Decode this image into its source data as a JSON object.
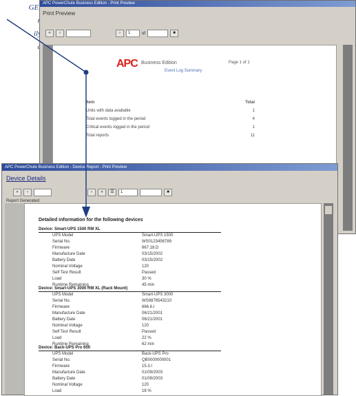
{
  "caption": [
    "GE:",
    "n",
    "ily",
    "d"
  ],
  "back_window": {
    "title": "APC PowerChute Business Edition - Print Preview",
    "app_heading": "Print Preview",
    "toolbar": {
      "zoom_value": "",
      "page_value": "1",
      "of_label": "of",
      "find_value": ""
    },
    "report": {
      "logo": "APC",
      "logo_text": "Business Edition",
      "logo_sub": "Event Log Summary",
      "right_text": "Page 1 of 1",
      "summary": {
        "header": [
          "Item",
          "Total"
        ],
        "rows": [
          [
            "Units with data available",
            "1"
          ],
          [
            "Total events logged in the period",
            "4"
          ],
          [
            "Critical events logged in the period",
            "1"
          ],
          [
            "Total reports",
            "11"
          ]
        ]
      }
    }
  },
  "front_window": {
    "title": "APC PowerChute Business Edition - Device Report - Print Preview",
    "heading": "Device Details",
    "toolbar": {
      "page_value": "1",
      "find_value": ""
    },
    "sub_label": "Report Generated",
    "report": {
      "title": "Detailed information for the following devices",
      "sections": [
        {
          "header": "Device: Smart-UPS 1500 RM XL",
          "rows": [
            [
              "UPS Model",
              "Smart-UPS 1500"
            ],
            [
              "Serial No.",
              "WS0123456789"
            ],
            [
              "Firmware",
              "667.18.D"
            ],
            [
              "Manufacture Date",
              "03/15/2002"
            ],
            [
              "Battery Date",
              "03/15/2002"
            ],
            [
              "Nominal Voltage",
              "120"
            ],
            [
              "Self Test Result",
              "Passed"
            ],
            [
              "Load",
              "30 %"
            ],
            [
              "Runtime Remaining",
              "45 min"
            ]
          ]
        },
        {
          "header": "Device: Smart-UPS 3000 RM XL (Rack Mount)",
          "rows": [
            [
              "UPS Model",
              "Smart-UPS 3000"
            ],
            [
              "Serial No.",
              "WS9876543210"
            ],
            [
              "Firmware",
              "666.6.I"
            ],
            [
              "Manufacture Date",
              "06/21/2001"
            ],
            [
              "Battery Date",
              "06/21/2001"
            ],
            [
              "Nominal Voltage",
              "120"
            ],
            [
              "Self Test Result",
              "Passed"
            ],
            [
              "Load",
              "22 %"
            ],
            [
              "Runtime Remaining",
              "62 min"
            ]
          ]
        },
        {
          "header": "Device: Back-UPS Pro 650",
          "rows": [
            [
              "UPS Model",
              "Back-UPS Pro"
            ],
            [
              "Serial No.",
              "QB0000000001"
            ],
            [
              "Firmware",
              "15.3.I"
            ],
            [
              "Manufacture Date",
              "01/09/2003"
            ],
            [
              "Battery Date",
              "01/09/2003"
            ],
            [
              "Nominal Voltage",
              "120"
            ],
            [
              "Load",
              "18 %"
            ]
          ]
        }
      ]
    }
  }
}
